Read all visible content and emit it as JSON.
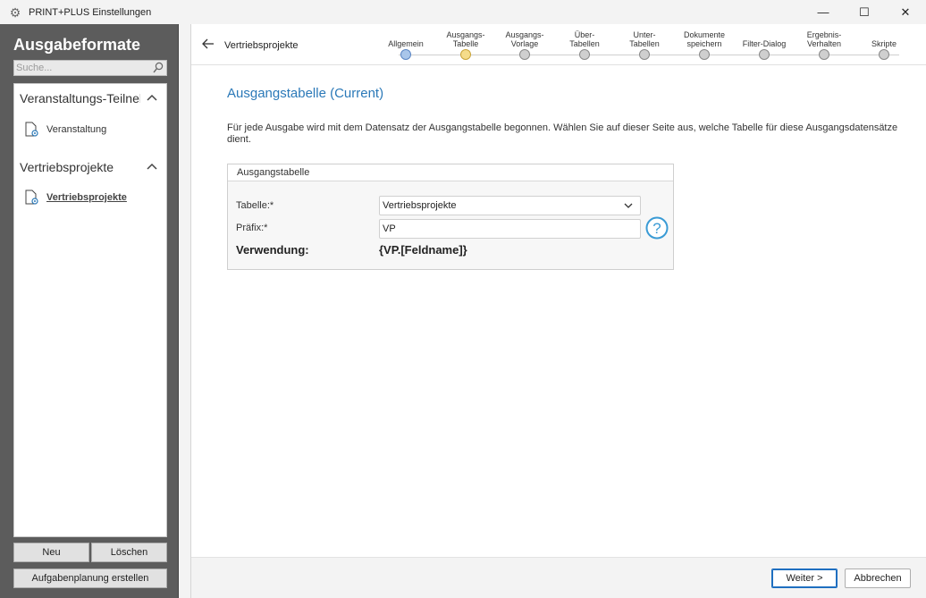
{
  "window": {
    "title": "PRINT+PLUS Einstellungen",
    "minimize_glyph": "—",
    "maximize_glyph": "☐",
    "close_glyph": "✕"
  },
  "sidebar": {
    "title": "Ausgabeformate",
    "search_placeholder": "Suche...",
    "groups": [
      {
        "label": "Veranstaltungs-Teilnehmer",
        "items": [
          {
            "label": "Veranstaltung",
            "active": false
          }
        ]
      },
      {
        "label": "Vertriebsprojekte",
        "items": [
          {
            "label": "Vertriebsprojekte",
            "active": true
          }
        ]
      }
    ],
    "buttons": {
      "new": "Neu",
      "delete": "Löschen",
      "schedule": "Aufgabenplanung erstellen"
    }
  },
  "header": {
    "breadcrumb": "Vertriebsprojekte",
    "steps": [
      {
        "line1": "",
        "line2": "Allgemein",
        "state": "done"
      },
      {
        "line1": "Ausgangs-",
        "line2": "Tabelle",
        "state": "current"
      },
      {
        "line1": "Ausgangs-",
        "line2": "Vorlage",
        "state": "todo"
      },
      {
        "line1": "Über-",
        "line2": "Tabellen",
        "state": "todo"
      },
      {
        "line1": "Unter-",
        "line2": "Tabellen",
        "state": "todo"
      },
      {
        "line1": "Dokumente",
        "line2": "speichern",
        "state": "todo"
      },
      {
        "line1": "",
        "line2": "Filter-Dialog",
        "state": "todo"
      },
      {
        "line1": "Ergebnis-",
        "line2": "Verhalten",
        "state": "todo"
      },
      {
        "line1": "",
        "line2": "Skripte",
        "state": "todo"
      }
    ]
  },
  "content": {
    "page_title": "Ausgangstabelle (Current)",
    "description": "Für jede Ausgabe wird mit dem Datensatz der Ausgangstabelle begonnen. Wählen Sie auf dieser Seite aus, welche Tabelle für diese Ausgangsdatensätze dient.",
    "group_title": "Ausgangstabelle",
    "table_label": "Tabelle:*",
    "table_value": "Vertriebsprojekte",
    "prefix_label": "Präfix:*",
    "prefix_value": "VP",
    "usage_label": "Verwendung:",
    "usage_value": "{VP.[Feldname]}"
  },
  "footer": {
    "next": "Weiter >",
    "cancel": "Abbrechen"
  },
  "colors": {
    "accent": "#2b79b8",
    "sidebar_bg": "#5c5c5c",
    "step_done": "#a9c6ea",
    "step_current": "#f5dc8a",
    "step_todo": "#cfcfcf"
  }
}
